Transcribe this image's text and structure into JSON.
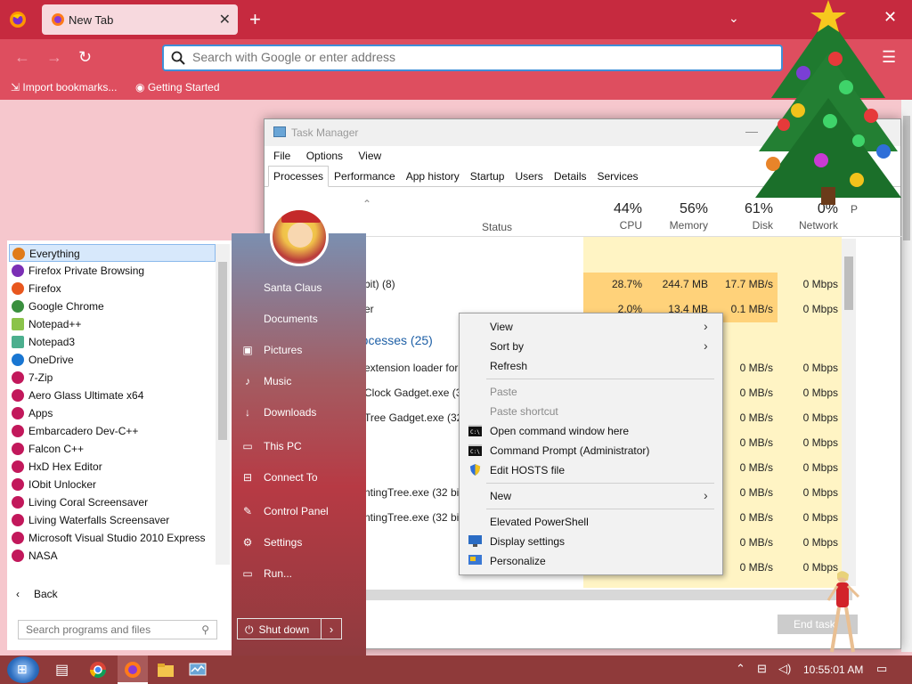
{
  "browser": {
    "tab_title": "New Tab",
    "url_placeholder": "Search with Google or enter address",
    "bookmarks": [
      "Import bookmarks...",
      "Getting Started"
    ]
  },
  "taskmgr": {
    "title": "Task Manager",
    "menu": [
      "File",
      "Options",
      "View"
    ],
    "tabs": [
      "Processes",
      "Performance",
      "App history",
      "Startup",
      "Users",
      "Details",
      "Services"
    ],
    "status_header": "Status",
    "columns": [
      {
        "pct": "44%",
        "label": "CPU"
      },
      {
        "pct": "56%",
        "label": "Memory"
      },
      {
        "pct": "61%",
        "label": "Disk"
      },
      {
        "pct": "0%",
        "label": "Network"
      },
      {
        "pct": "",
        "label": "P"
      }
    ],
    "rows": [
      {
        "name": "bit) (8)",
        "cpu": "28.7%",
        "mem": "244.7 MB",
        "disk": "17.7 MB/s",
        "net": "0 Mbps"
      },
      {
        "name": "er",
        "cpu": "2.0%",
        "mem": "13.4 MB",
        "disk": "0.1 MB/s",
        "net": "0 Mbps"
      }
    ],
    "background_title": "rocesses (25)",
    "bg_rows": [
      {
        "name": "extension loader for",
        "disk": "0 MB/s",
        "net": "0 Mbps"
      },
      {
        "name": "Clock Gadget.exe (32",
        "disk": "0 MB/s",
        "net": "0 Mbps"
      },
      {
        "name": "Tree Gadget.exe (32 b",
        "disk": "0 MB/s",
        "net": "0 Mbps"
      },
      {
        "name": "",
        "disk": "0 MB/s",
        "net": "0 Mbps"
      },
      {
        "name": "",
        "disk": "0 MB/s",
        "net": "0 Mbps"
      },
      {
        "name": "ntingTree.exe (32 bit",
        "disk": "0 MB/s",
        "net": "0 Mbps"
      },
      {
        "name": "ntingTree.exe (32 bit",
        "disk": "0 MB/s",
        "net": "0 Mbps"
      },
      {
        "name": "",
        "disk": "0 MB/s",
        "net": "0 Mbps"
      },
      {
        "name": "",
        "disk": "0 MB/s",
        "net": "0 Mbps"
      }
    ],
    "end_task": "End task"
  },
  "context_menu": {
    "items": [
      {
        "label": "View",
        "submenu": true,
        "disabled": false,
        "icon": ""
      },
      {
        "label": "Sort by",
        "submenu": true,
        "disabled": false,
        "icon": ""
      },
      {
        "label": "Refresh",
        "submenu": false,
        "disabled": false,
        "icon": ""
      },
      {
        "label": "Paste",
        "submenu": false,
        "disabled": true,
        "icon": ""
      },
      {
        "label": "Paste shortcut",
        "submenu": false,
        "disabled": true,
        "icon": ""
      },
      {
        "label": "Open command window here",
        "submenu": false,
        "disabled": false,
        "icon": "cmd-icon"
      },
      {
        "label": "Command Prompt (Administrator)",
        "submenu": false,
        "disabled": false,
        "icon": "cmd-icon"
      },
      {
        "label": "Edit HOSTS file",
        "submenu": false,
        "disabled": false,
        "icon": "shield-icon"
      },
      {
        "label": "New",
        "submenu": true,
        "disabled": false,
        "icon": ""
      },
      {
        "label": "Elevated PowerShell",
        "submenu": false,
        "disabled": false,
        "icon": ""
      },
      {
        "label": "Display settings",
        "submenu": false,
        "disabled": false,
        "icon": "display-icon"
      },
      {
        "label": "Personalize",
        "submenu": false,
        "disabled": false,
        "icon": "personalize-icon"
      }
    ]
  },
  "start_menu": {
    "programs": [
      {
        "label": "Everything",
        "color": "#e07b1a"
      },
      {
        "label": "Firefox Private Browsing",
        "color": "#7b2fb5"
      },
      {
        "label": "Firefox",
        "color": "#e8571e"
      },
      {
        "label": "Google Chrome",
        "color": "#3a8f3e"
      },
      {
        "label": "Notepad++",
        "color": "#8bc34a"
      },
      {
        "label": "Notepad3",
        "color": "#4caf8e"
      },
      {
        "label": "OneDrive",
        "color": "#1976d2"
      },
      {
        "label": "7-Zip",
        "color": "#c2185b"
      },
      {
        "label": "Aero Glass Ultimate x64",
        "color": "#c2185b"
      },
      {
        "label": "Apps",
        "color": "#c2185b"
      },
      {
        "label": "Embarcadero Dev-C++",
        "color": "#c2185b"
      },
      {
        "label": "Falcon C++",
        "color": "#c2185b"
      },
      {
        "label": "HxD Hex Editor",
        "color": "#c2185b"
      },
      {
        "label": "IObit Unlocker",
        "color": "#c2185b"
      },
      {
        "label": "Living Coral Screensaver",
        "color": "#c2185b"
      },
      {
        "label": "Living Waterfalls Screensaver",
        "color": "#c2185b"
      },
      {
        "label": "Microsoft Visual Studio 2010 Express",
        "color": "#c2185b"
      },
      {
        "label": "NASA",
        "color": "#c2185b"
      }
    ],
    "back": "Back",
    "search_placeholder": "Search programs and files",
    "links": [
      "Santa Claus",
      "Documents",
      "Pictures",
      "Music",
      "Downloads",
      "This PC",
      "Connect To",
      "Control Panel",
      "Settings",
      "Run..."
    ],
    "shutdown": "Shut down"
  },
  "taskbar": {
    "clock": "10:55:01 AM"
  }
}
